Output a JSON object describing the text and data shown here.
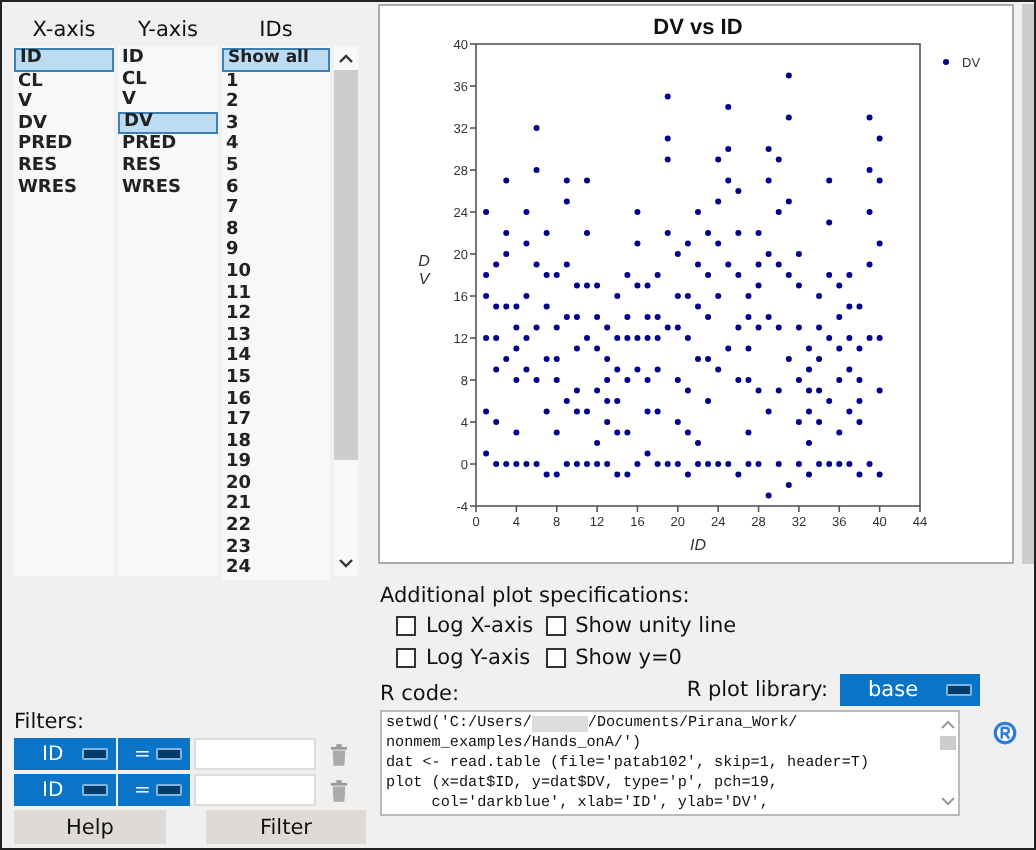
{
  "x_axis": {
    "header": "X-axis",
    "items": [
      {
        "label": "ID",
        "selected": true
      },
      {
        "label": "CL",
        "selected": false
      },
      {
        "label": "V",
        "selected": false
      },
      {
        "label": "DV",
        "selected": false
      },
      {
        "label": "PRED",
        "selected": false
      },
      {
        "label": "RES",
        "selected": false
      },
      {
        "label": "WRES",
        "selected": false
      }
    ]
  },
  "y_axis": {
    "header": "Y-axis",
    "items": [
      {
        "label": "ID",
        "selected": false
      },
      {
        "label": "CL",
        "selected": false
      },
      {
        "label": "V",
        "selected": false
      },
      {
        "label": "DV",
        "selected": true
      },
      {
        "label": "PRED",
        "selected": false
      },
      {
        "label": "RES",
        "selected": false
      },
      {
        "label": "WRES",
        "selected": false
      }
    ]
  },
  "ids": {
    "header": "IDs",
    "items": [
      {
        "label": "Show all",
        "selected": true
      },
      {
        "label": "1",
        "selected": false
      },
      {
        "label": "2",
        "selected": false
      },
      {
        "label": "3",
        "selected": false
      },
      {
        "label": "4",
        "selected": false
      },
      {
        "label": "5",
        "selected": false
      },
      {
        "label": "6",
        "selected": false
      },
      {
        "label": "7",
        "selected": false
      },
      {
        "label": "8",
        "selected": false
      },
      {
        "label": "9",
        "selected": false
      },
      {
        "label": "10",
        "selected": false
      },
      {
        "label": "11",
        "selected": false
      },
      {
        "label": "12",
        "selected": false
      },
      {
        "label": "13",
        "selected": false
      },
      {
        "label": "14",
        "selected": false
      },
      {
        "label": "15",
        "selected": false
      },
      {
        "label": "16",
        "selected": false
      },
      {
        "label": "17",
        "selected": false
      },
      {
        "label": "18",
        "selected": false
      },
      {
        "label": "19",
        "selected": false
      },
      {
        "label": "20",
        "selected": false
      },
      {
        "label": "21",
        "selected": false
      },
      {
        "label": "22",
        "selected": false
      },
      {
        "label": "23",
        "selected": false
      },
      {
        "label": "24",
        "selected": false
      }
    ]
  },
  "plot": {
    "chart_data": {
      "type": "scatter",
      "title": "DV vs ID",
      "xlabel": "ID",
      "ylabel": "DV",
      "xlim": [
        0,
        44
      ],
      "ylim": [
        -4,
        40
      ],
      "xticks": [
        0,
        4,
        8,
        12,
        16,
        20,
        24,
        28,
        32,
        36,
        40,
        44
      ],
      "yticks": [
        -4,
        0,
        4,
        8,
        12,
        16,
        20,
        24,
        28,
        32,
        36,
        40
      ],
      "x": [
        1,
        1,
        1,
        1,
        1,
        1,
        2,
        2,
        2,
        2,
        2,
        2,
        3,
        3,
        3,
        3,
        3,
        3,
        4,
        4,
        4,
        4,
        4,
        4,
        5,
        5,
        5,
        5,
        5,
        5,
        6,
        6,
        6,
        6,
        6,
        6,
        7,
        7,
        7,
        7,
        7,
        7,
        8,
        8,
        8,
        8,
        8,
        8,
        9,
        9,
        9,
        9,
        9,
        9,
        10,
        10,
        10,
        10,
        10,
        10,
        11,
        11,
        11,
        11,
        11,
        11,
        12,
        12,
        12,
        12,
        12,
        12,
        13,
        13,
        13,
        13,
        13,
        13,
        14,
        14,
        14,
        14,
        14,
        14,
        15,
        15,
        15,
        15,
        15,
        15,
        16,
        16,
        16,
        16,
        16,
        16,
        17,
        17,
        17,
        17,
        17,
        17,
        18,
        18,
        18,
        18,
        18,
        18,
        19,
        19,
        19,
        19,
        19,
        19,
        20,
        20,
        20,
        20,
        20,
        20,
        21,
        21,
        21,
        21,
        21,
        21,
        22,
        22,
        22,
        22,
        22,
        22,
        23,
        23,
        23,
        23,
        23,
        23,
        24,
        24,
        24,
        24,
        24,
        24,
        25,
        25,
        25,
        25,
        25,
        25,
        26,
        26,
        26,
        26,
        26,
        26,
        27,
        27,
        27,
        27,
        27,
        27,
        28,
        28,
        28,
        28,
        28,
        28,
        29,
        29,
        29,
        29,
        29,
        29,
        30,
        30,
        30,
        30,
        30,
        30,
        31,
        31,
        31,
        31,
        31,
        31,
        32,
        32,
        32,
        32,
        32,
        32,
        33,
        33,
        33,
        33,
        33,
        33,
        34,
        34,
        34,
        34,
        34,
        34,
        35,
        35,
        35,
        35,
        35,
        35,
        36,
        36,
        36,
        36,
        36,
        36,
        37,
        37,
        37,
        37,
        37,
        37,
        38,
        38,
        38,
        38,
        38,
        38,
        39,
        39,
        39,
        39,
        39,
        39,
        40,
        40,
        40,
        40,
        40,
        40
      ],
      "series": [
        {
          "name": "DV",
          "color": "#00008b",
          "values": [
            24,
            18,
            16,
            12,
            5,
            1,
            19,
            15,
            12,
            9,
            4,
            0,
            27,
            22,
            20,
            15,
            10,
            0,
            15,
            13,
            11,
            8,
            3,
            0,
            24,
            21,
            16,
            12,
            9,
            0,
            32,
            28,
            19,
            13,
            8,
            0,
            22,
            18,
            15,
            10,
            5,
            -1,
            18,
            13,
            10,
            8,
            3,
            -1,
            27,
            25,
            19,
            14,
            6,
            0,
            17,
            14,
            11,
            7,
            5,
            0,
            27,
            22,
            17,
            12,
            5,
            0,
            17,
            14,
            11,
            7,
            2,
            0,
            13,
            10,
            8,
            6,
            4,
            0,
            16,
            12,
            9,
            6,
            3,
            -1,
            18,
            14,
            12,
            8,
            3,
            -1,
            24,
            21,
            17,
            12,
            9,
            0,
            17,
            14,
            12,
            8,
            5,
            1,
            18,
            14,
            12,
            9,
            5,
            0,
            35,
            31,
            29,
            22,
            13,
            0,
            20,
            16,
            13,
            8,
            4,
            0,
            21,
            16,
            12,
            7,
            3,
            -1,
            24,
            19,
            15,
            10,
            2,
            0,
            22,
            18,
            14,
            10,
            6,
            0,
            29,
            25,
            21,
            16,
            9,
            0,
            34,
            30,
            27,
            19,
            11,
            0,
            26,
            22,
            18,
            13,
            8,
            -1,
            16,
            14,
            11,
            8,
            3,
            0,
            22,
            19,
            17,
            13,
            7,
            0,
            30,
            27,
            20,
            14,
            5,
            -3,
            29,
            24,
            19,
            13,
            7,
            0,
            37,
            33,
            25,
            18,
            10,
            -2,
            20,
            17,
            13,
            8,
            4,
            0,
            11,
            9,
            7,
            5,
            2,
            -1,
            16,
            13,
            10,
            7,
            4,
            0,
            27,
            23,
            18,
            12,
            6,
            0,
            17,
            14,
            11,
            8,
            3,
            0,
            18,
            15,
            12,
            9,
            5,
            0,
            15,
            11,
            8,
            6,
            4,
            -1,
            33,
            28,
            24,
            19,
            12,
            0,
            31,
            27,
            21,
            12,
            7,
            -1
          ]
        }
      ]
    }
  },
  "additional": {
    "title": "Additional plot specifications:",
    "options": [
      {
        "label": "Log X-axis",
        "checked": false
      },
      {
        "label": "Show unity line",
        "checked": false
      },
      {
        "label": "Log Y-axis",
        "checked": false
      },
      {
        "label": "Show y=0",
        "checked": false
      }
    ]
  },
  "r_code": {
    "label": "R code:",
    "lines": [
      [
        "setwd('C:/Users/",
        "/Documents/Pirana_Work/"
      ],
      [
        "nonmem_examples/Hands_onA/')"
      ],
      [
        "dat <- read.table (file='patab102', skip=1, header=T)"
      ],
      [
        "plot (x=dat$ID, y=dat$DV, type='p', pch=19,"
      ],
      [
        "     col='darkblue', xlab='ID', ylab='DV',"
      ]
    ]
  },
  "r_plot_library": {
    "label": "R plot library:",
    "value": "base"
  },
  "filters": {
    "label": "Filters:",
    "rows": [
      {
        "column": "ID",
        "operator": "="
      },
      {
        "column": "ID",
        "operator": "="
      }
    ]
  },
  "buttons": [
    "Help",
    "Filter"
  ]
}
